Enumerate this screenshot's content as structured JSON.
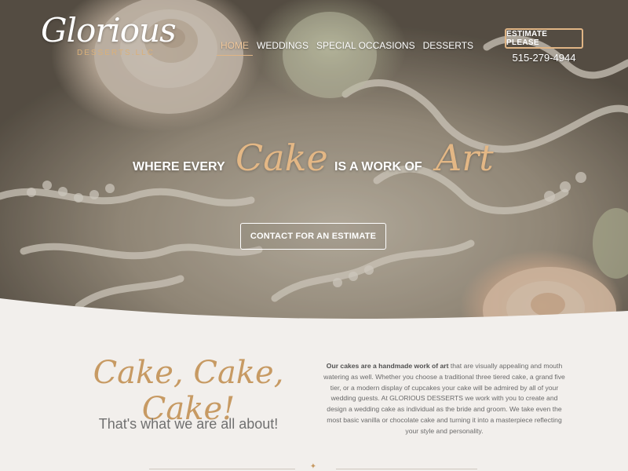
{
  "brand": {
    "logo_script": "Glorious",
    "logo_sub": "DESSERTS.LLC"
  },
  "nav": {
    "items": [
      {
        "label": "HOME",
        "active": true
      },
      {
        "label": "WEDDINGS",
        "active": false
      },
      {
        "label": "SPECIAL OCCASIONS",
        "active": false
      },
      {
        "label": "DESSERTS",
        "active": false
      }
    ]
  },
  "header": {
    "estimate_label": "ESTIMATE PLEASE",
    "phone": "515-279-4944"
  },
  "hero": {
    "tag_1": "WHERE EVERY",
    "tag_script_1": "Cake",
    "tag_2": "IS A WORK OF",
    "tag_script_2": "Art",
    "cta_label": "CONTACT FOR AN ESTIMATE"
  },
  "about": {
    "heading": "Cake, Cake, Cake!",
    "subheading": "That's what we are all about!",
    "body_bold": "Our cakes are a handmade work of art",
    "body_rest": " that are visually appealing and mouth watering as well. Whether you choose a traditional three tiered cake, a grand five tier, or a modern display of cupcakes your cake will be admired by all of your wedding guests. At GLORIOUS DESSERTS we work with you to create and design a wedding cake as individual as the bride and groom. We take even the most basic vanilla or chocolate cake and turning it into a masterpiece reflecting your style and personality."
  },
  "colors": {
    "accent_gold": "#c79a63",
    "page_background": "#f2efec",
    "button_border": "#e0b585"
  }
}
